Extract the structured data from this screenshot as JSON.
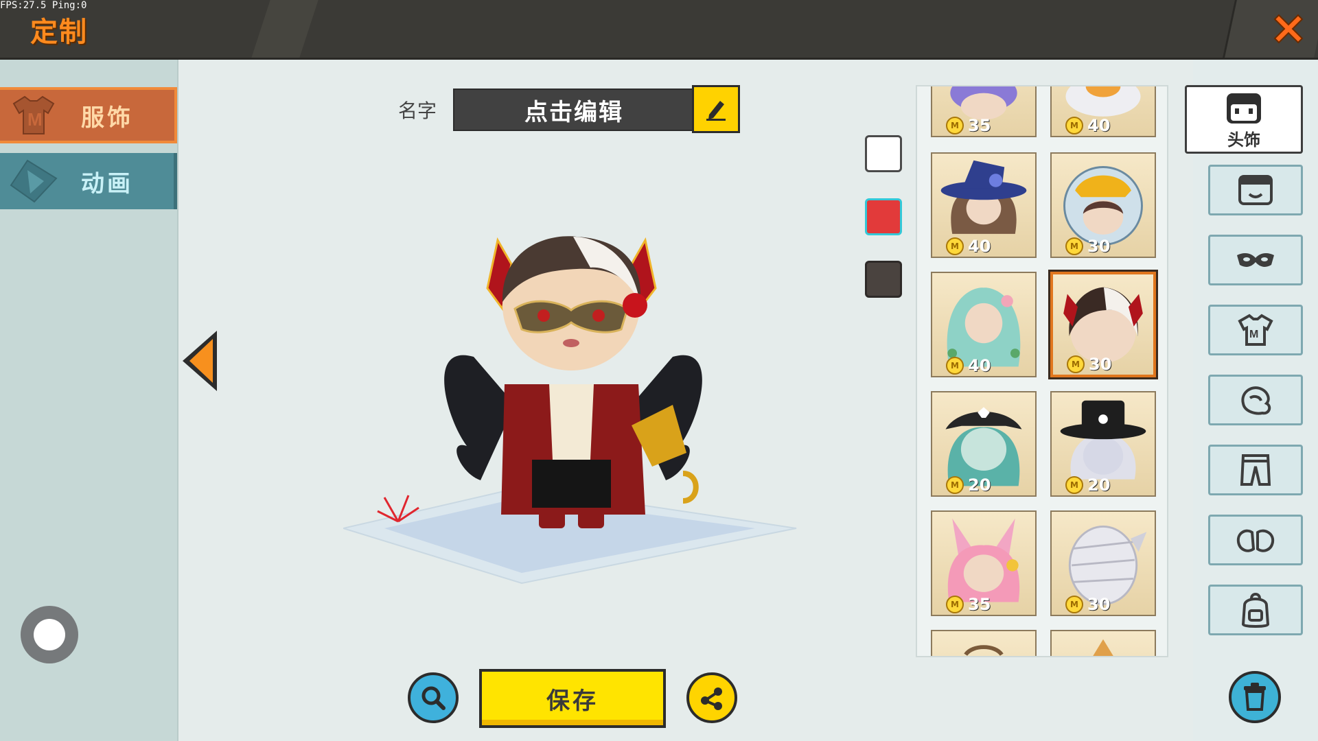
{
  "status": {
    "fps_text": "FPS:27.5  Ping:0"
  },
  "header": {
    "title": "定制",
    "close_icon": "close-x-icon"
  },
  "left_tabs": [
    {
      "label": "服饰",
      "icon": "shirt-m-icon",
      "active": true
    },
    {
      "label": "动画",
      "icon": "triangle-play-icon",
      "active": false
    }
  ],
  "name": {
    "label": "名字",
    "value": "点击编辑",
    "edit_icon": "pencil-icon"
  },
  "colors": {
    "accent_orange": "#f08a3a",
    "swatches": [
      {
        "color": "#ffffff",
        "selected": false
      },
      {
        "color": "#e23a3a",
        "selected": true
      },
      {
        "color": "#4a433f",
        "selected": false
      }
    ]
  },
  "actions": {
    "save_label": "保存",
    "zoom_icon": "magnifier-icon",
    "share_icon": "share-icon"
  },
  "items": [
    {
      "price": "35",
      "art": "purple-hair",
      "partial": "top"
    },
    {
      "price": "40",
      "art": "white-hair-pumpkin",
      "partial": "top"
    },
    {
      "price": "40",
      "art": "blue-witch-hat"
    },
    {
      "price": "30",
      "art": "space-helmet"
    },
    {
      "price": "40",
      "art": "teal-hair-flowers"
    },
    {
      "price": "30",
      "art": "black-white-hair-horns",
      "selected": true
    },
    {
      "price": "20",
      "art": "pirate-hat-teal-hair"
    },
    {
      "price": "20",
      "art": "top-hat-white-hair"
    },
    {
      "price": "35",
      "art": "pink-bunny-hair"
    },
    {
      "price": "30",
      "art": "bandage-head"
    },
    {
      "price": "",
      "art": "partial-1",
      "partial": "bottom"
    },
    {
      "price": "",
      "art": "partial-2",
      "partial": "bottom"
    }
  ],
  "categories": [
    {
      "label": "头饰",
      "icon": "head-icon",
      "active": true
    },
    {
      "label": "",
      "icon": "face-icon"
    },
    {
      "label": "",
      "icon": "mask-icon"
    },
    {
      "label": "",
      "icon": "shirt-icon"
    },
    {
      "label": "",
      "icon": "hand-glove-icon"
    },
    {
      "label": "",
      "icon": "pants-icon"
    },
    {
      "label": "",
      "icon": "shoes-icon"
    },
    {
      "label": "",
      "icon": "backpack-icon"
    }
  ],
  "trash_icon": "trash-icon"
}
